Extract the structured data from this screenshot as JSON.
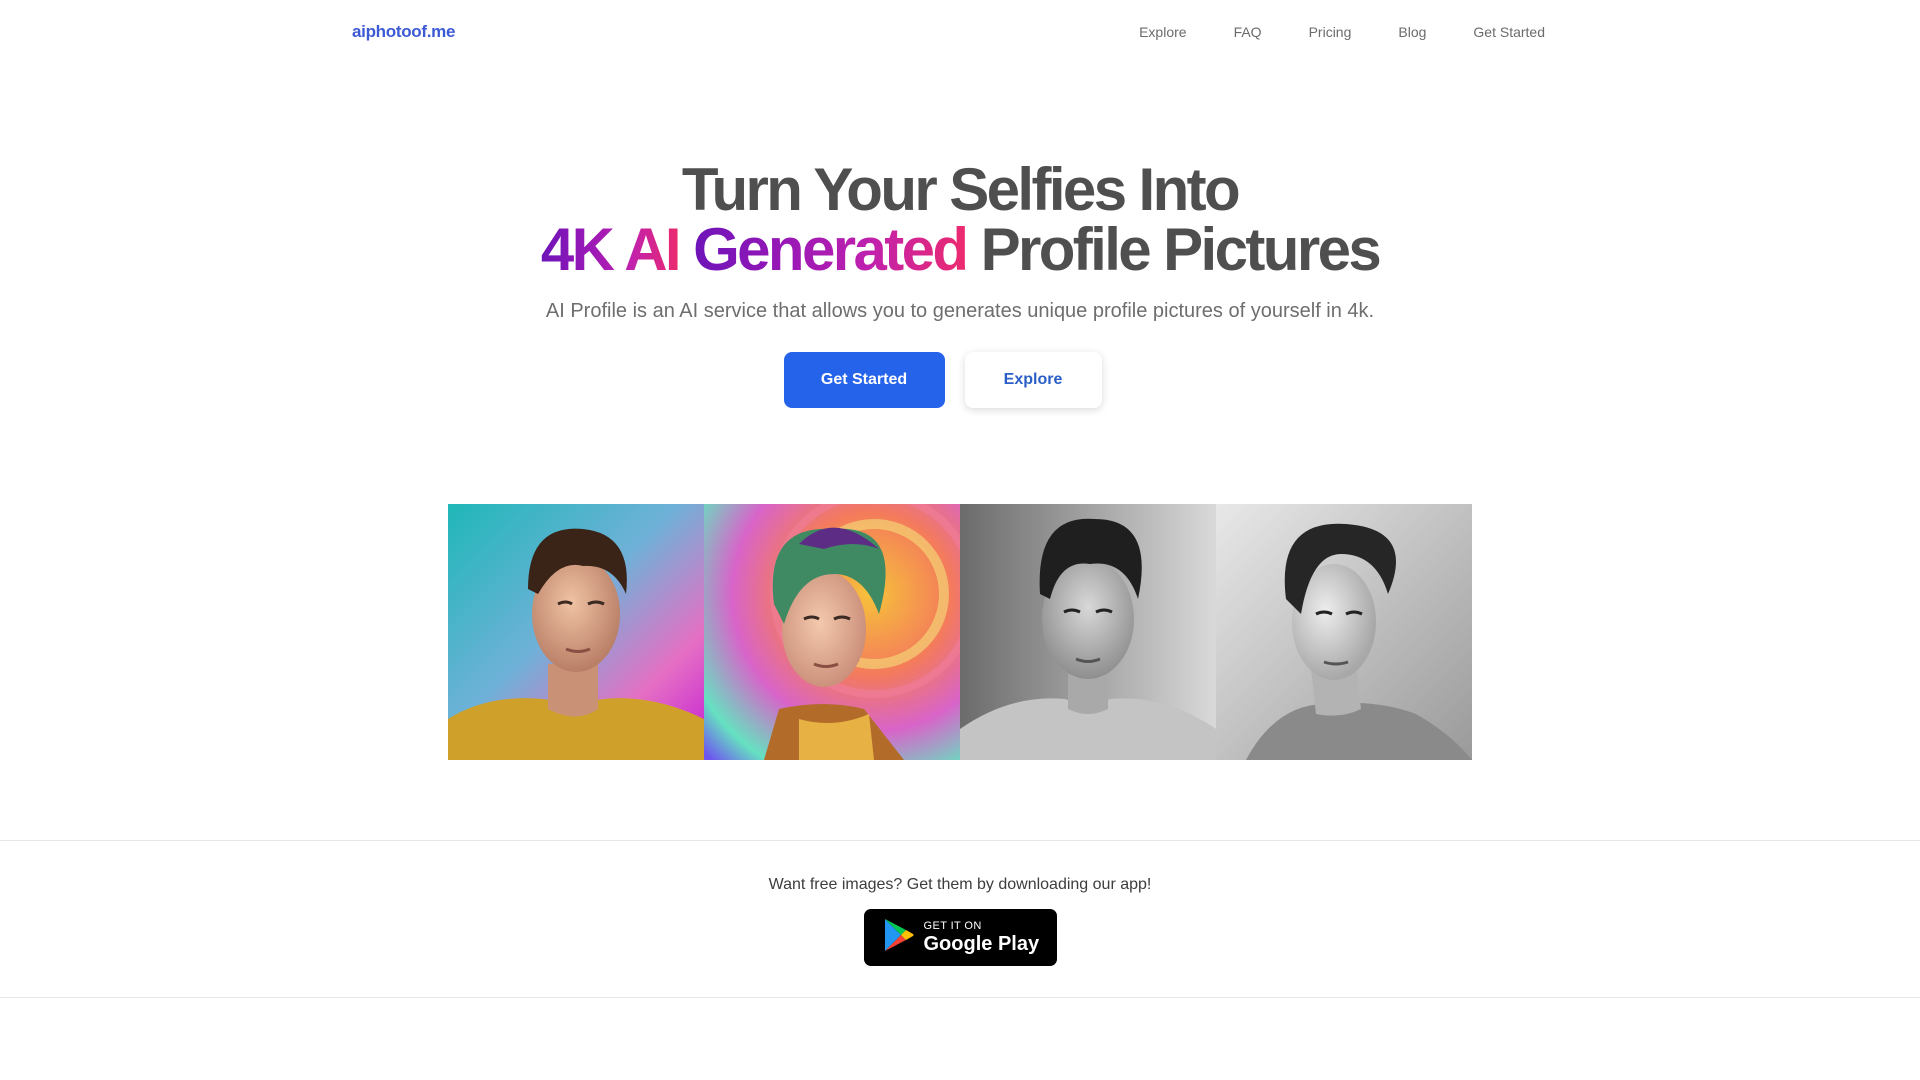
{
  "nav": {
    "logo": "aiphotoof.me",
    "links": [
      "Explore",
      "FAQ",
      "Pricing",
      "Blog",
      "Get Started"
    ]
  },
  "hero": {
    "title_line1": "Turn Your Selfies Into",
    "title_highlight_a": "4K AI",
    "title_highlight_b": "Generated",
    "title_rest": "Profile Pictures",
    "subtitle": "AI Profile is an AI service that allows you to generates unique profile pictures of yourself in 4k.",
    "primary_cta": "Get Started",
    "secondary_cta": "Explore"
  },
  "gallery": {
    "images": [
      "portrait-yellow-shirt-gradient-background",
      "portrait-colorful-illustrated-style",
      "portrait-black-white-photo-tshirt",
      "portrait-black-white-pencil-sketch"
    ]
  },
  "app": {
    "text": "Want free images? Get them by downloading our app!",
    "badge_small": "GET IT ON",
    "badge_big": "Google Play"
  },
  "colors": {
    "brand_blue": "#2563eb",
    "logo_blue": "#3d5ad6",
    "gradient_start": "#6d14b8",
    "gradient_end": "#ec2a6e",
    "heading_gray": "#4f4f4f"
  }
}
